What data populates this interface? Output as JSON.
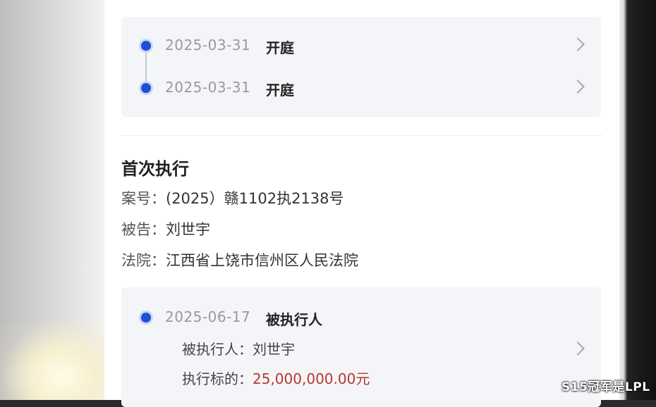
{
  "top_timeline": [
    {
      "date": "2025-03-31",
      "label": "开庭"
    },
    {
      "date": "2025-03-31",
      "label": "开庭"
    }
  ],
  "execution": {
    "title": "首次执行",
    "case_label": "案号：",
    "case_value": "(2025）赣1102执2138号",
    "defendant_label": "被告：",
    "defendant_value": "刘世宇",
    "court_label": "法院：",
    "court_value": "江西省上饶市信州区人民法院",
    "event": {
      "date": "2025-06-17",
      "label": "被执行人",
      "person_label": "被执行人：",
      "person_value": "刘世宇",
      "amount_label": "执行标的：",
      "amount_value": "25,000,000.00元"
    }
  },
  "watermark": "S15冠军是LPL",
  "colors": {
    "accent": "#1e50d4",
    "amount": "#b5372e",
    "card_bg": "#f4f5f8"
  }
}
